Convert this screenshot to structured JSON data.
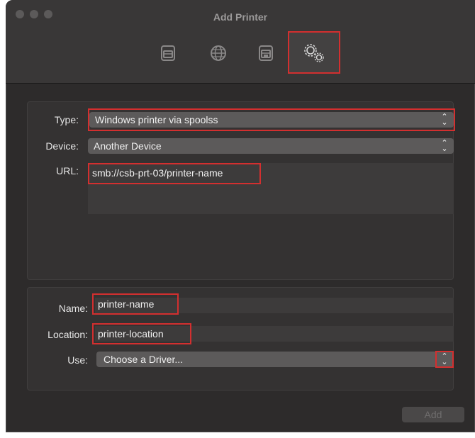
{
  "window": {
    "title": "Add Printer"
  },
  "toolbar": {
    "items": [
      {
        "icon": "printer-icon"
      },
      {
        "icon": "globe-icon"
      },
      {
        "icon": "fax-printer-icon"
      },
      {
        "icon": "gears-icon",
        "selected": true
      }
    ]
  },
  "connection": {
    "type_label": "Type:",
    "type_value": "Windows printer via spoolss",
    "device_label": "Device:",
    "device_value": "Another Device",
    "url_label": "URL:",
    "url_value": "smb://csb-prt-03/printer-name"
  },
  "details": {
    "name_label": "Name:",
    "name_value": "printer-name",
    "location_label": "Location:",
    "location_value": "printer-location",
    "use_label": "Use:",
    "use_value": "Choose a Driver..."
  },
  "footer": {
    "add_label": "Add"
  },
  "colors": {
    "highlight": "#d32f2f",
    "window_bg": "#2d2b2b"
  }
}
